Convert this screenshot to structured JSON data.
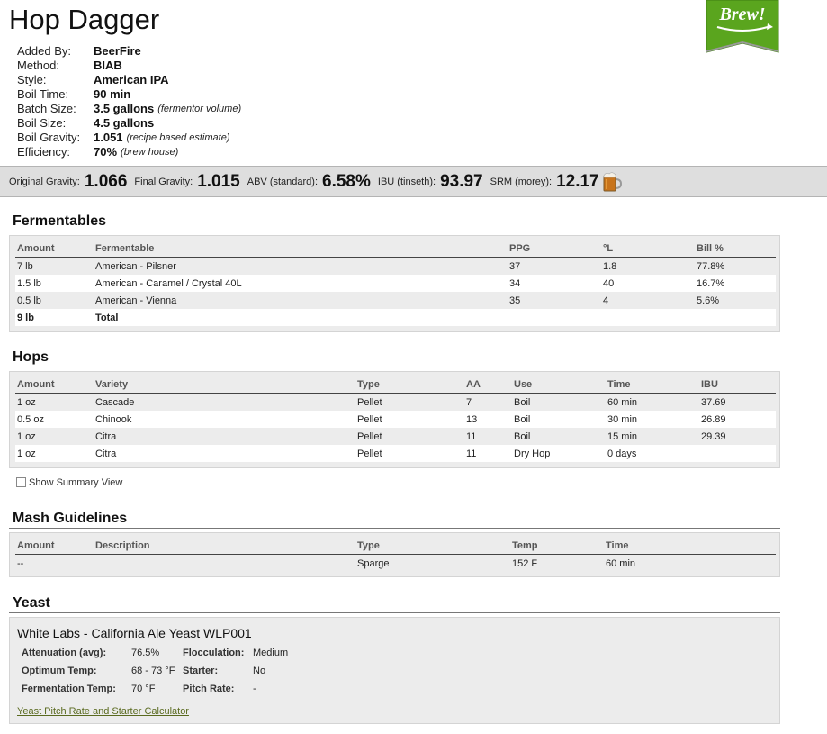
{
  "recipe": {
    "title": "Hop Dagger",
    "badge_text": "Brew!",
    "meta": [
      {
        "label": "Added By:",
        "value": "BeerFire",
        "note": ""
      },
      {
        "label": "Method:",
        "value": "BIAB",
        "note": ""
      },
      {
        "label": "Style:",
        "value": "American IPA",
        "note": ""
      },
      {
        "label": "Boil Time:",
        "value": "90 min",
        "note": ""
      },
      {
        "label": "Batch Size:",
        "value": "3.5 gallons",
        "note": "(fermentor volume)"
      },
      {
        "label": "Boil Size:",
        "value": "4.5 gallons",
        "note": ""
      },
      {
        "label": "Boil Gravity:",
        "value": "1.051",
        "note": "(recipe based estimate)"
      },
      {
        "label": "Efficiency:",
        "value": "70%",
        "note": "(brew house)"
      }
    ]
  },
  "stats": [
    {
      "label": "Original Gravity:",
      "value": "1.066"
    },
    {
      "label": "Final Gravity:",
      "value": "1.015"
    },
    {
      "label": "ABV (standard):",
      "value": "6.58%"
    },
    {
      "label": "IBU (tinseth):",
      "value": "93.97"
    },
    {
      "label": "SRM (morey):",
      "value": "12.17"
    }
  ],
  "colors": {
    "badge_green": "#5aa51e",
    "srm_color": "#c8741c",
    "link": "#5a6a1f"
  },
  "fermentables": {
    "heading": "Fermentables",
    "columns": [
      "Amount",
      "Fermentable",
      "PPG",
      "°L",
      "Bill %"
    ],
    "rows": [
      [
        "7 lb",
        "American - Pilsner",
        "37",
        "1.8",
        "77.8%"
      ],
      [
        "1.5 lb",
        "American - Caramel / Crystal 40L",
        "34",
        "40",
        "16.7%"
      ],
      [
        "0.5 lb",
        "American - Vienna",
        "35",
        "4",
        "5.6%"
      ]
    ],
    "total": [
      "9 lb",
      "Total"
    ]
  },
  "hops": {
    "heading": "Hops",
    "columns": [
      "Amount",
      "Variety",
      "Type",
      "AA",
      "Use",
      "Time",
      "IBU"
    ],
    "rows": [
      [
        "1 oz",
        "Cascade",
        "Pellet",
        "7",
        "Boil",
        "60 min",
        "37.69"
      ],
      [
        "0.5 oz",
        "Chinook",
        "Pellet",
        "13",
        "Boil",
        "30 min",
        "26.89"
      ],
      [
        "1 oz",
        "Citra",
        "Pellet",
        "11",
        "Boil",
        "15 min",
        "29.39"
      ],
      [
        "1 oz",
        "Citra",
        "Pellet",
        "11",
        "Dry Hop",
        "0 days",
        ""
      ]
    ],
    "summary_toggle": "Show Summary View"
  },
  "mash": {
    "heading": "Mash Guidelines",
    "columns": [
      "Amount",
      "Description",
      "Type",
      "Temp",
      "Time"
    ],
    "rows": [
      [
        "--",
        "",
        "Sparge",
        "152 F",
        "60 min"
      ]
    ]
  },
  "yeast": {
    "heading": "Yeast",
    "name": "White Labs - California Ale Yeast WLP001",
    "attenuation_label": "Attenuation (avg):",
    "attenuation": "76.5%",
    "flocculation_label": "Flocculation:",
    "flocculation": "Medium",
    "optimum_label": "Optimum Temp:",
    "optimum": "68 - 73 °F",
    "starter_label": "Starter:",
    "starter": "No",
    "ferm_temp_label": "Fermentation Temp:",
    "ferm_temp": "70 °F",
    "pitch_label": "Pitch Rate:",
    "pitch": "-",
    "calculator_link": "Yeast Pitch Rate and Starter Calculator"
  }
}
